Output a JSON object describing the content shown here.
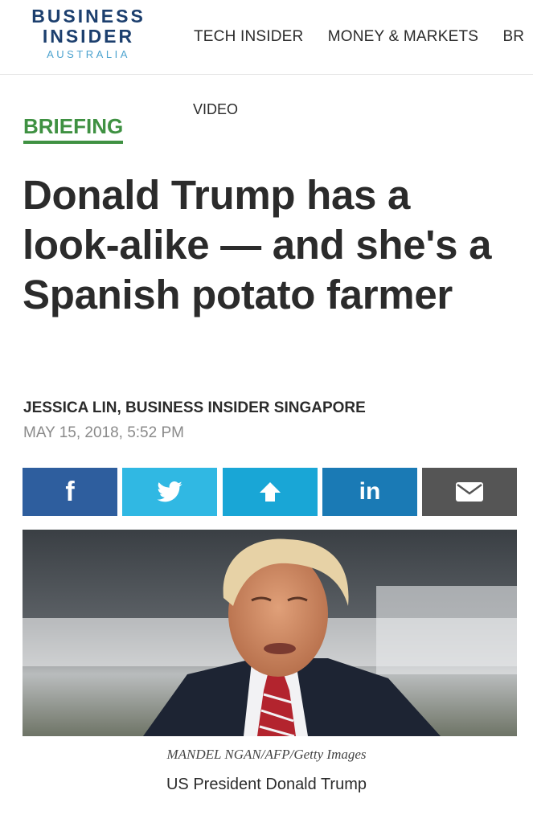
{
  "header": {
    "logo": {
      "line1": "BUSINESS",
      "line2": "INSIDER",
      "sub": "AUSTRALIA"
    },
    "nav": [
      "TECH INSIDER",
      "MONEY & MARKETS",
      "BR"
    ]
  },
  "article": {
    "video_link": "VIDEO",
    "category": "BRIEFING",
    "headline": "Donald Trump has a look-alike — and she's a Spanish potato farmer",
    "byline": "JESSICA LIN, BUSINESS INSIDER SINGAPORE",
    "date": "MAY 15, 2018, 5:52 PM",
    "image_credit": "MANDEL NGAN/AFP/Getty Images",
    "image_caption": "US President Donald Trump"
  },
  "share": [
    {
      "icon": "facebook-icon",
      "label": "f",
      "color": "#2e5e9e"
    },
    {
      "icon": "twitter-icon",
      "label": "",
      "color": "#30b8e3"
    },
    {
      "icon": "share-icon",
      "label": "",
      "color": "#19a6d6"
    },
    {
      "icon": "linkedin-icon",
      "label": "in",
      "color": "#1a7ab5"
    },
    {
      "icon": "email-icon",
      "label": "",
      "color": "#555555"
    }
  ],
  "colors": {
    "brand_navy": "#1c3f6e",
    "brand_light_blue": "#4da3cf",
    "briefing_green": "#3f9142",
    "text": "#2b2b2b",
    "muted": "#8a8a8a"
  }
}
